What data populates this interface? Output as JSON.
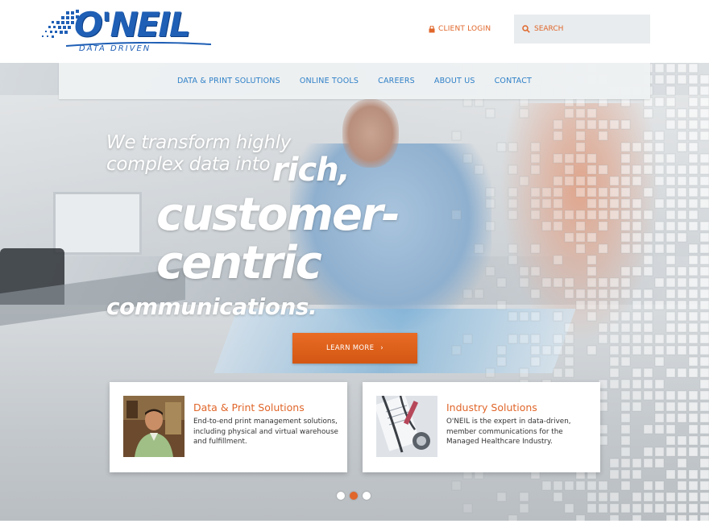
{
  "header": {
    "logo_text": "O'NEIL",
    "logo_tagline": "DATA DRIVEN",
    "client_login_label": "CLIENT LOGIN",
    "search_placeholder": "SEARCH"
  },
  "nav": {
    "items": [
      {
        "label": "DATA & PRINT SOLUTIONS"
      },
      {
        "label": "ONLINE TOOLS"
      },
      {
        "label": "CAREERS"
      },
      {
        "label": "ABOUT US"
      },
      {
        "label": "CONTACT"
      }
    ]
  },
  "hero": {
    "line1": "We transform highly",
    "line2": "complex data into",
    "line2_emphasis": "rich,",
    "line3": "customer-",
    "line4": "centric",
    "line5": "communications.",
    "cta_label": "LEARN MORE",
    "cta_arrow": "›"
  },
  "cards": [
    {
      "title": "Data & Print Solutions",
      "text": "End-to-end print management solutions, including physical and virtual warehouse and fulfillment."
    },
    {
      "title": "Industry Solutions",
      "text": "O'NEIL is the expert in data-driven, member communications for the Managed Healthcare Industry."
    }
  ],
  "carousel": {
    "total": 3,
    "active_index": 2
  },
  "colors": {
    "brand_blue": "#1f5fb5",
    "nav_blue": "#2f80c8",
    "accent_orange": "#e0662a"
  },
  "icons": {
    "client_login": "lock-icon",
    "search": "search-icon",
    "cta": "chevron-right-icon"
  }
}
